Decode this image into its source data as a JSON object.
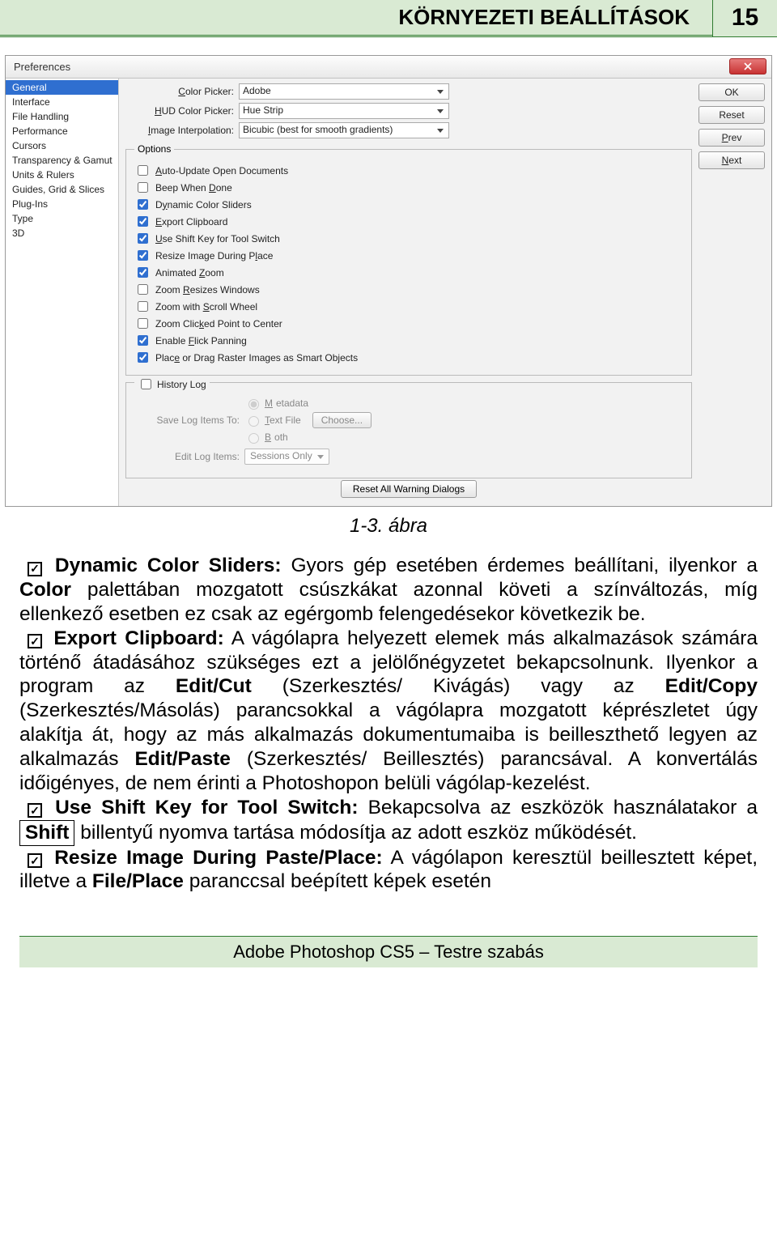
{
  "header": {
    "title": "KÖRNYEZETI BEÁLLÍTÁSOK",
    "page": "15"
  },
  "dialog": {
    "title": "Preferences",
    "sidebar": [
      "General",
      "Interface",
      "File Handling",
      "Performance",
      "Cursors",
      "Transparency & Gamut",
      "Units & Rulers",
      "Guides, Grid & Slices",
      "Plug-Ins",
      "Type",
      "3D"
    ],
    "selected_index": 0,
    "buttons": {
      "ok": "OK",
      "reset": "Reset",
      "prev": "Prev",
      "next": "Next"
    },
    "dropdowns": {
      "color_picker": {
        "label": "Color Picker:",
        "value": "Adobe"
      },
      "hud": {
        "label": "HUD Color Picker:",
        "value": "Hue Strip"
      },
      "interp": {
        "label": "Image Interpolation:",
        "value": "Bicubic (best for smooth gradients)"
      }
    },
    "options_legend": "Options",
    "options": [
      {
        "label": "Auto-Update Open Documents",
        "checked": false
      },
      {
        "label": "Beep When Done",
        "checked": false
      },
      {
        "label": "Dynamic Color Sliders",
        "checked": true
      },
      {
        "label": "Export Clipboard",
        "checked": true
      },
      {
        "label": "Use Shift Key for Tool Switch",
        "checked": true
      },
      {
        "label": "Resize Image During Place",
        "checked": true
      },
      {
        "label": "Animated Zoom",
        "checked": true
      },
      {
        "label": "Zoom Resizes Windows",
        "checked": false
      },
      {
        "label": "Zoom with Scroll Wheel",
        "checked": false
      },
      {
        "label": "Zoom Clicked Point to Center",
        "checked": false
      },
      {
        "label": "Enable Flick Panning",
        "checked": true
      },
      {
        "label": "Place or Drag Raster Images as Smart Objects",
        "checked": true
      }
    ],
    "history": {
      "legend": "History Log",
      "save_label": "Save Log Items To:",
      "radios": {
        "metadata": "Metadata",
        "textfile": "Text File",
        "both": "Both"
      },
      "choose": "Choose...",
      "edit_label": "Edit Log Items:",
      "edit_value": "Sessions Only"
    },
    "reset_all": "Reset All Warning Dialogs"
  },
  "caption": "1-3. ábra",
  "para": {
    "dyncolor_lead": "Dynamic Color Sliders:",
    "dyncolor_body": " Gyors gép esetében érdemes beállítani, ilyenkor a ",
    "color_word": "Color",
    "dyncolor_body2": " palettában mozgatott csúszkákat azonnal követi a színváltozás, míg ellenkező esetben ez csak az egérgomb felengedésekor következik be.",
    "export_lead": "Export Clipboard:",
    "export_body1": " A vágólapra helyezett elemek más alkalmazások számára történő átadásához szükséges ezt a jelölőnégyzetet bekapcsolnunk. Ilyenkor a program az ",
    "editcut": "Edit/Cut",
    "export_body2": " (Szerkesztés/ Kivágás) vagy az ",
    "editcopy": "Edit/Copy",
    "export_body3": " (Szerkesztés/Másolás) parancsokkal a vágólapra mozgatott képrészletet úgy alakítja át, hogy az más alkalmazás dokumentumaiba is beilleszthető legyen az alkalmazás ",
    "editpaste": "Edit/Paste",
    "export_body4": " (Szerkesztés/ Beillesztés) parancsával. A konvertálás időigényes, de nem érinti a Photoshopon belüli vágólap-kezelést.",
    "shift_lead": "Use Shift Key for Tool Switch:",
    "shift_body1": " Bekapcsolva az eszközök használatakor a ",
    "shift_key": "Shift",
    "shift_body2": " billentyű nyomva tartása módosítja az adott eszköz működését.",
    "resize_lead": "Resize Image During Paste/Place:",
    "resize_body": " A vágólapon keresztül beillesztett képet, illetve a ",
    "fileplace": "File/Place",
    "resize_body2": " paranccsal beépített képek esetén"
  },
  "footer": "Adobe Photoshop CS5 – Testre szabás"
}
